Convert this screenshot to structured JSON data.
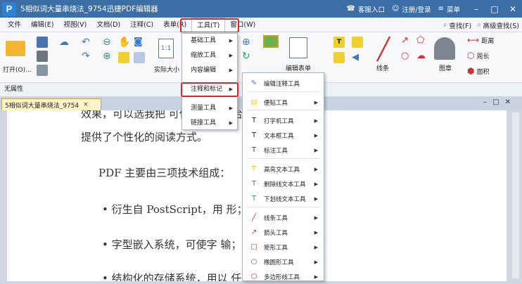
{
  "titlebar": {
    "logo": "P",
    "title": "5相似词大量串烧法_9754迅捷PDF编辑器",
    "report": "客服入口",
    "login": "注册/登录",
    "menu": "菜单"
  },
  "menubar": {
    "items": [
      "文件",
      "编辑(E)",
      "视图(V)",
      "文档(D)",
      "注释(C)",
      "表单(R)",
      "工具(T)",
      "窗口(W)"
    ],
    "find": "查找(F)",
    "advanced_find": "高级查找(S)"
  },
  "ribbon": {
    "open": "打开(O)...",
    "actual_size": "实际大小",
    "edit_form": "编辑表单",
    "line": "线条",
    "stamp": "图章",
    "distance": "距离",
    "perimeter": "周长",
    "area": "面积"
  },
  "propbar": {
    "label": "无属性"
  },
  "doctab": {
    "name": "5相似词大量串烧法_9754",
    "close": "×"
  },
  "document": {
    "line1": "效果，可以选我把                                    可任意调节，给读者",
    "line2": "提供了个性化的阅读方式。",
    "line3": "PDF 主要由三项技术组成：",
    "line4": "•  衍生自 PostScript，用                              形；",
    "line5": "•  字型嵌入系统，可使字                               输；",
    "line6": "•  结构化的存储系统，用以                            任何"
  },
  "tools_menu": {
    "items": [
      {
        "label": "基础工具",
        "selected": false
      },
      {
        "label": "缩放工具",
        "selected": false
      },
      {
        "label": "内容编辑",
        "selected": false
      },
      {
        "label": "注释和标记",
        "selected": true
      },
      {
        "label": "测量工具",
        "selected": false
      },
      {
        "label": "链接工具",
        "selected": false
      }
    ]
  },
  "annotation_submenu": {
    "items": [
      {
        "label": "编辑注释工具",
        "icon": "edit-annotation-icon",
        "glyph": "✎",
        "color": "#3a78c8",
        "arrow": false
      },
      {
        "label": "便贴工具",
        "icon": "sticky-note-icon",
        "glyph": "▤",
        "color": "#f0d030",
        "arrow": true
      },
      {
        "label": "打字机工具",
        "icon": "typewriter-icon",
        "glyph": "T",
        "color": "#222222",
        "arrow": true
      },
      {
        "label": "文本框工具",
        "icon": "textbox-icon",
        "glyph": "T",
        "color": "#222222",
        "arrow": true
      },
      {
        "label": "标注工具",
        "icon": "callout-icon",
        "glyph": "T",
        "color": "#c02020",
        "arrow": true
      },
      {
        "label": "高亮文本工具",
        "icon": "highlight-icon",
        "glyph": "T",
        "color": "#e8c020",
        "arrow": true
      },
      {
        "label": "删除线文本工具",
        "icon": "strikethrough-icon",
        "glyph": "T",
        "color": "#3a78c8",
        "arrow": true
      },
      {
        "label": "下划线文本工具",
        "icon": "underline-icon",
        "glyph": "T",
        "color": "#2a9a6a",
        "arrow": true
      },
      {
        "label": "线条工具",
        "icon": "line-icon",
        "glyph": "╱",
        "color": "#d03030",
        "arrow": true
      },
      {
        "label": "箭头工具",
        "icon": "arrow-icon",
        "glyph": "↗",
        "color": "#d03030",
        "arrow": true
      },
      {
        "label": "矩形工具",
        "icon": "rectangle-icon",
        "glyph": "□",
        "color": "#d03030",
        "arrow": true
      },
      {
        "label": "椭圆形工具",
        "icon": "ellipse-icon",
        "glyph": "○",
        "color": "#d03030",
        "arrow": true
      },
      {
        "label": "多边形线工具",
        "icon": "polyline-icon",
        "glyph": "⬡",
        "color": "#d03030",
        "arrow": true
      }
    ]
  }
}
